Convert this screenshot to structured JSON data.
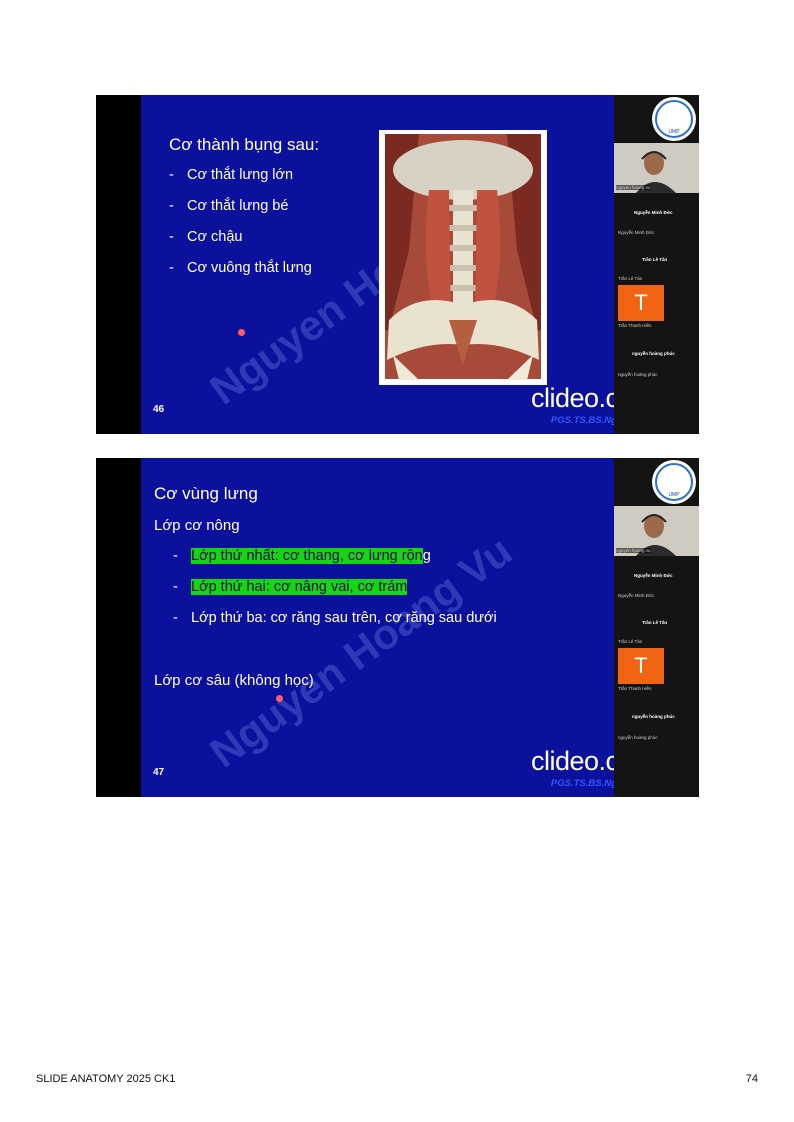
{
  "footer": {
    "left": "SLIDE ANATOMY 2025 CK1",
    "page": "74"
  },
  "watermark_text": "Clideo.com",
  "colors": {
    "slide_bg": "#0b119c",
    "highlight": "#16d612",
    "avatar_bg": "#f06414",
    "author": "#3355ff"
  },
  "slides": [
    {
      "title": "Cơ thành bụng sau:",
      "bullets": [
        "Cơ thắt lưng lớn",
        "Cơ thắt lưng bé",
        "Cơ chậu",
        "Cơ vuông thắt lưng"
      ],
      "number": "46",
      "author": "PGS.TS.BS.Nguyễn Hoàng Vũ",
      "watermark": "Nguyen Hoang Vu",
      "image_icon": "posterior-abdominal-wall-anatomy-illustration",
      "clideo": "clideo.com"
    },
    {
      "title": "Cơ vùng lưng",
      "subtitle": "Lớp cơ nông",
      "bullets": [
        {
          "hl": "Lớp thứ nhất: cơ thang, cơ lưng rộn",
          "rest": "g"
        },
        {
          "hl": "Lớp thứ hai: cơ nâng vai, cơ trám",
          "rest": ""
        },
        {
          "hl": "",
          "rest": "Lớp thứ ba: cơ răng sau trên, cơ răng sau dưới"
        }
      ],
      "extra": "Lớp cơ sâu (không học)",
      "number": "47",
      "author": "PGS.TS.BS.Nguyễn Hoàng Vũ",
      "watermark": "Nguyen Hoang Vu",
      "clideo": "clideo.com"
    }
  ],
  "participants": {
    "logo_text": "UMP",
    "speaker_label": "nguyen hoang vu",
    "names": [
      "Nguyễn Minh Đức",
      "Nguyễn Minh Đức",
      "Trần Lê Tân",
      "Trần Lê Tân",
      "Trần Thanh Hiền",
      "nguyễn hoàng phúc",
      "nguyễn hoàng phúc"
    ],
    "avatar_letter": "T"
  }
}
